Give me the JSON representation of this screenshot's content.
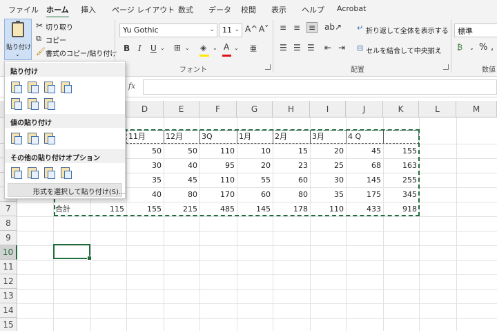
{
  "menu": {
    "tabs": [
      "ファイル",
      "ホーム",
      "挿入",
      "ページ レイアウト",
      "数式",
      "データ",
      "校閲",
      "表示",
      "ヘルプ",
      "Acrobat"
    ],
    "active": "ホーム"
  },
  "ribbon": {
    "clipboard": {
      "paste_label": "貼り付け",
      "cut_label": "切り取り",
      "copy_label": "コピー",
      "format_painter_label": "書式のコピー/貼り付け"
    },
    "font": {
      "font_name": "Yu Gothic",
      "font_size": "11",
      "increase_size": "A^",
      "decrease_size": "A˅",
      "bold": "B",
      "italic": "I",
      "underline": "U",
      "group_label": "フォント",
      "text_color_label": "A",
      "phonetic_label": "亜"
    },
    "alignment": {
      "wrap_text_label": "折り返して全体を表示する",
      "merge_center_label": "セルを結合して中央揃え",
      "group_label": "配置"
    },
    "number": {
      "format": "標準",
      "percent": "%",
      "group_label": "数値"
    }
  },
  "formula_bar": {
    "fx": "fx",
    "value": ""
  },
  "columns": [
    "D",
    "E",
    "F",
    "G",
    "H",
    "I",
    "J",
    "K",
    "L",
    "M"
  ],
  "rows": [
    "7",
    "8",
    "9",
    "10",
    "11",
    "12",
    "13",
    "14",
    "15"
  ],
  "active_row": "10",
  "table": {
    "header": [
      "11月",
      "12月",
      "3Q",
      "1月",
      "2月",
      "3月",
      "4 Q",
      ""
    ],
    "rows": [
      [
        "50",
        "50",
        "110",
        "10",
        "15",
        "20",
        "45",
        "155"
      ],
      [
        "30",
        "40",
        "95",
        "20",
        "23",
        "25",
        "68",
        "163"
      ],
      [
        "35",
        "45",
        "110",
        "55",
        "60",
        "30",
        "145",
        "255"
      ],
      [
        "40",
        "80",
        "170",
        "60",
        "80",
        "35",
        "175",
        "345"
      ]
    ],
    "total_label": "合計",
    "total_c": "115",
    "total_row": [
      "155",
      "215",
      "485",
      "145",
      "178",
      "110",
      "433",
      "918"
    ]
  },
  "paste_menu": {
    "section_paste": "貼り付け",
    "section_values": "値の貼り付け",
    "section_other": "その他の貼り付けオプション",
    "paste_special": "形式を選択して貼り付け(S)..."
  },
  "colors": {
    "accent": "#1e6b3c",
    "ribbon_bg": "#f3f3f3"
  }
}
